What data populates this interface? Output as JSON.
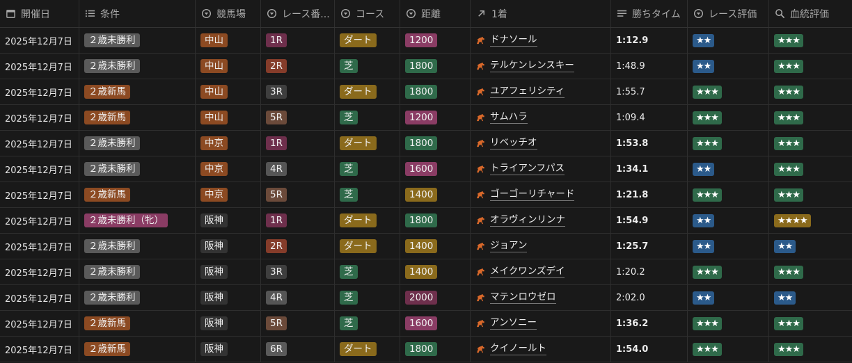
{
  "headers": [
    {
      "label": "開催日",
      "icon": "calendar-icon"
    },
    {
      "label": "条件",
      "icon": "list-icon"
    },
    {
      "label": "競馬場",
      "icon": "select-icon"
    },
    {
      "label": "レース番...",
      "icon": "select-icon"
    },
    {
      "label": "コース",
      "icon": "select-icon"
    },
    {
      "label": "距離",
      "icon": "select-icon"
    },
    {
      "label": "1着",
      "icon": "relation-arrow-icon"
    },
    {
      "label": "勝ちタイム",
      "icon": "text-lines-icon"
    },
    {
      "label": "レース評価",
      "icon": "select-icon"
    },
    {
      "label": "血統評価",
      "icon": "search-icon"
    }
  ],
  "colors": {
    "cond_gray": "#5a5a5a",
    "cond_orange": "#8c4a22",
    "cond_pink": "#8a3c64",
    "venue_orange": "#8c4a22",
    "venue_dark": "#333333",
    "race_1R": "#6e2f4c",
    "race_2R": "#853c2a",
    "race_3R": "#3e3e3e",
    "race_4R": "#555555",
    "race_5R": "#6b4a3a",
    "race_6R": "#5a5a5a",
    "course_dirt": "#8a6a1c",
    "course_turf": "#2f6a4a",
    "dist_1200": "#8a3c64",
    "dist_1400": "#8a6a1c",
    "dist_1600": "#8a3c64",
    "dist_1800": "#2f6a4a",
    "dist_2000": "#6e2f4c",
    "eval_2": "#2b5a8a",
    "eval_3": "#2f6a4a",
    "eval_4": "#8a6a1c",
    "horse_icon": "#d8682a"
  },
  "rows": [
    {
      "date": "2025年12月7日",
      "condition": "２歳未勝利",
      "cond_color": "cond_gray",
      "venue": "中山",
      "venue_color": "venue_orange",
      "race": "1R",
      "course": "ダート",
      "distance": "1200",
      "winner": "ドナソール",
      "time": "1:12.9",
      "time_bold": true,
      "race_eval": "★★",
      "race_eval_level": 2,
      "blood_eval": "★★★",
      "blood_eval_level": 3
    },
    {
      "date": "2025年12月7日",
      "condition": "２歳未勝利",
      "cond_color": "cond_gray",
      "venue": "中山",
      "venue_color": "venue_orange",
      "race": "2R",
      "course": "芝",
      "distance": "1800",
      "winner": "テルケンレンスキー",
      "time": "1:48.9",
      "time_bold": false,
      "race_eval": "★★",
      "race_eval_level": 2,
      "blood_eval": "★★★",
      "blood_eval_level": 3
    },
    {
      "date": "2025年12月7日",
      "condition": "２歳新馬",
      "cond_color": "cond_orange",
      "venue": "中山",
      "venue_color": "venue_orange",
      "race": "3R",
      "course": "ダート",
      "distance": "1800",
      "winner": "ユアフェリシティ",
      "time": "1:55.7",
      "time_bold": false,
      "race_eval": "★★★",
      "race_eval_level": 3,
      "blood_eval": "★★★",
      "blood_eval_level": 3
    },
    {
      "date": "2025年12月7日",
      "condition": "２歳新馬",
      "cond_color": "cond_orange",
      "venue": "中山",
      "venue_color": "venue_orange",
      "race": "5R",
      "course": "芝",
      "distance": "1200",
      "winner": "サムハラ",
      "time": "1:09.4",
      "time_bold": false,
      "race_eval": "★★★",
      "race_eval_level": 3,
      "blood_eval": "★★★",
      "blood_eval_level": 3
    },
    {
      "date": "2025年12月7日",
      "condition": "２歳未勝利",
      "cond_color": "cond_gray",
      "venue": "中京",
      "venue_color": "venue_orange",
      "race": "1R",
      "course": "ダート",
      "distance": "1800",
      "winner": "リベッチオ",
      "time": "1:53.8",
      "time_bold": true,
      "race_eval": "★★★",
      "race_eval_level": 3,
      "blood_eval": "★★★",
      "blood_eval_level": 3
    },
    {
      "date": "2025年12月7日",
      "condition": "２歳未勝利",
      "cond_color": "cond_gray",
      "venue": "中京",
      "venue_color": "venue_orange",
      "race": "4R",
      "course": "芝",
      "distance": "1600",
      "winner": "トライアンフパス",
      "time": "1:34.1",
      "time_bold": true,
      "race_eval": "★★",
      "race_eval_level": 2,
      "blood_eval": "★★★",
      "blood_eval_level": 3
    },
    {
      "date": "2025年12月7日",
      "condition": "２歳新馬",
      "cond_color": "cond_orange",
      "venue": "中京",
      "venue_color": "venue_orange",
      "race": "5R",
      "course": "芝",
      "distance": "1400",
      "winner": "ゴーゴーリチャード",
      "time": "1:21.8",
      "time_bold": true,
      "race_eval": "★★★",
      "race_eval_level": 3,
      "blood_eval": "★★★",
      "blood_eval_level": 3
    },
    {
      "date": "2025年12月7日",
      "condition": "２歳未勝利（牝）",
      "cond_color": "cond_pink",
      "venue": "阪神",
      "venue_color": "venue_dark",
      "race": "1R",
      "course": "ダート",
      "distance": "1800",
      "winner": "オラヴィンリンナ",
      "time": "1:54.9",
      "time_bold": true,
      "race_eval": "★★",
      "race_eval_level": 2,
      "blood_eval": "★★★★",
      "blood_eval_level": 4
    },
    {
      "date": "2025年12月7日",
      "condition": "２歳未勝利",
      "cond_color": "cond_gray",
      "venue": "阪神",
      "venue_color": "venue_dark",
      "race": "2R",
      "course": "ダート",
      "distance": "1400",
      "winner": "ジョアン",
      "time": "1:25.7",
      "time_bold": true,
      "race_eval": "★★",
      "race_eval_level": 2,
      "blood_eval": "★★",
      "blood_eval_level": 2
    },
    {
      "date": "2025年12月7日",
      "condition": "２歳未勝利",
      "cond_color": "cond_gray",
      "venue": "阪神",
      "venue_color": "venue_dark",
      "race": "3R",
      "course": "芝",
      "distance": "1400",
      "winner": "メイクワンズデイ",
      "time": "1:20.2",
      "time_bold": false,
      "race_eval": "★★★",
      "race_eval_level": 3,
      "blood_eval": "★★★",
      "blood_eval_level": 3
    },
    {
      "date": "2025年12月7日",
      "condition": "２歳未勝利",
      "cond_color": "cond_gray",
      "venue": "阪神",
      "venue_color": "venue_dark",
      "race": "4R",
      "course": "芝",
      "distance": "2000",
      "winner": "マテンロウゼロ",
      "time": "2:02.0",
      "time_bold": false,
      "race_eval": "★★",
      "race_eval_level": 2,
      "blood_eval": "★★",
      "blood_eval_level": 2
    },
    {
      "date": "2025年12月7日",
      "condition": "２歳新馬",
      "cond_color": "cond_orange",
      "venue": "阪神",
      "venue_color": "venue_dark",
      "race": "5R",
      "course": "芝",
      "distance": "1600",
      "winner": "アンソニー",
      "time": "1:36.2",
      "time_bold": true,
      "race_eval": "★★★",
      "race_eval_level": 3,
      "blood_eval": "★★★",
      "blood_eval_level": 3
    },
    {
      "date": "2025年12月7日",
      "condition": "２歳新馬",
      "cond_color": "cond_orange",
      "venue": "阪神",
      "venue_color": "venue_dark",
      "race": "6R",
      "course": "ダート",
      "distance": "1800",
      "winner": "クイノールト",
      "time": "1:54.0",
      "time_bold": true,
      "race_eval": "★★★",
      "race_eval_level": 3,
      "blood_eval": "★★★",
      "blood_eval_level": 3
    }
  ]
}
